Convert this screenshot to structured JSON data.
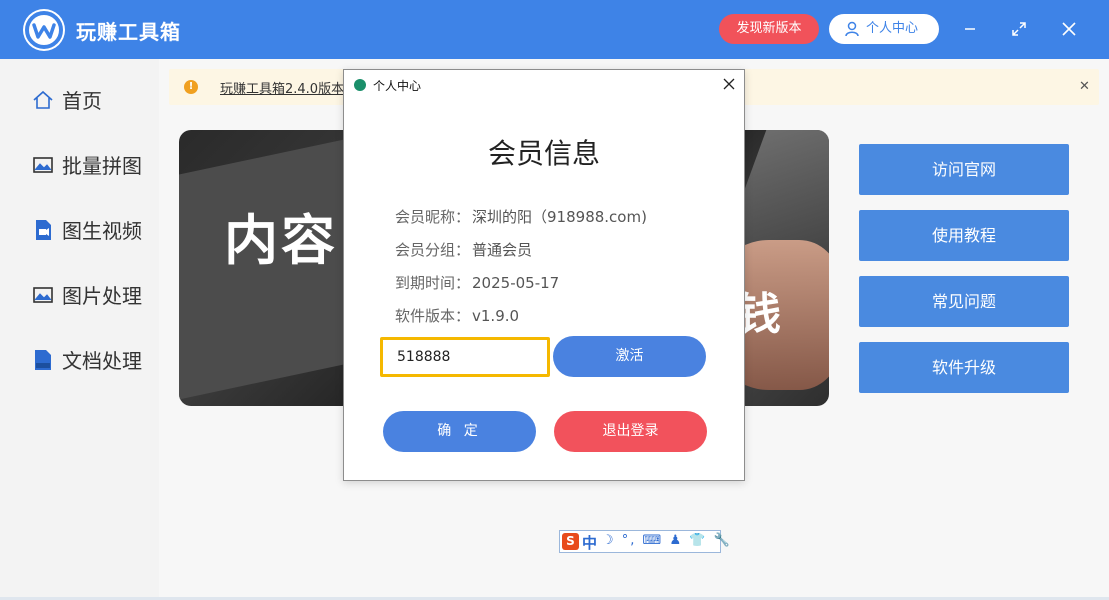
{
  "app": {
    "title": "玩赚工具箱",
    "new_version_label": "发现新版本",
    "user_center_label": "个人中心"
  },
  "sidebar": {
    "items": [
      {
        "label": "首页",
        "icon": "home-icon"
      },
      {
        "label": "批量拼图",
        "icon": "image-icon"
      },
      {
        "label": "图生视频",
        "icon": "video-file-icon"
      },
      {
        "label": "图片处理",
        "icon": "image-icon"
      },
      {
        "label": "文档处理",
        "icon": "doc-file-icon"
      }
    ]
  },
  "notice": {
    "text": "玩赚工具箱2.4.0版本"
  },
  "banner": {
    "text_left": "内容",
    "text_right": "钱"
  },
  "side_buttons": [
    "访问官网",
    "使用教程",
    "常见问题",
    "软件升级"
  ],
  "ime": {
    "logo": "S",
    "mode": "中",
    "icons": "☽ °, ⌨ ♟ 👕 🔧"
  },
  "dialog": {
    "window_title": "个人中心",
    "heading": "会员信息",
    "rows": [
      {
        "label": "会员昵称：",
        "value": "深圳的阳（918988.com)"
      },
      {
        "label": "会员分组：",
        "value": "普通会员"
      },
      {
        "label": "到期时间：",
        "value": "2025-05-17"
      },
      {
        "label": "软件版本：",
        "value": "v1.9.0"
      }
    ],
    "code_value": "518888",
    "activate_label": "激活",
    "ok_label": "确 定",
    "logout_label": "退出登录"
  },
  "colors": {
    "primary": "#3e83e7",
    "danger": "#f1525a",
    "highlight_border": "#f5b800"
  }
}
